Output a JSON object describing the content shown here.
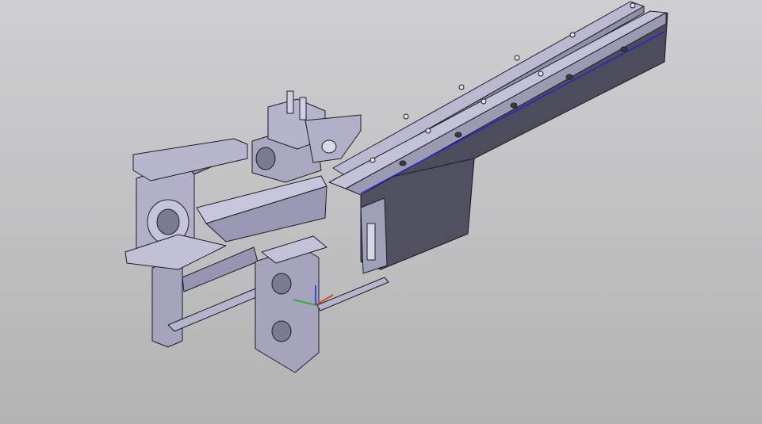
{
  "viewport": {
    "background_top": "#cfcfd1",
    "background_bottom": "#b3b3b4"
  },
  "model": {
    "face_light": "#c9c9db",
    "face_mid": "#9d9db6",
    "face_dark": "#4c4c5c",
    "edge_color": "#1d1d27",
    "highlight_edge": "#2424c8"
  },
  "compass": {
    "x_axis_color": "#d24a2a",
    "y_axis_color": "#3aaa3a",
    "z_axis_color": "#3a4ad2"
  }
}
